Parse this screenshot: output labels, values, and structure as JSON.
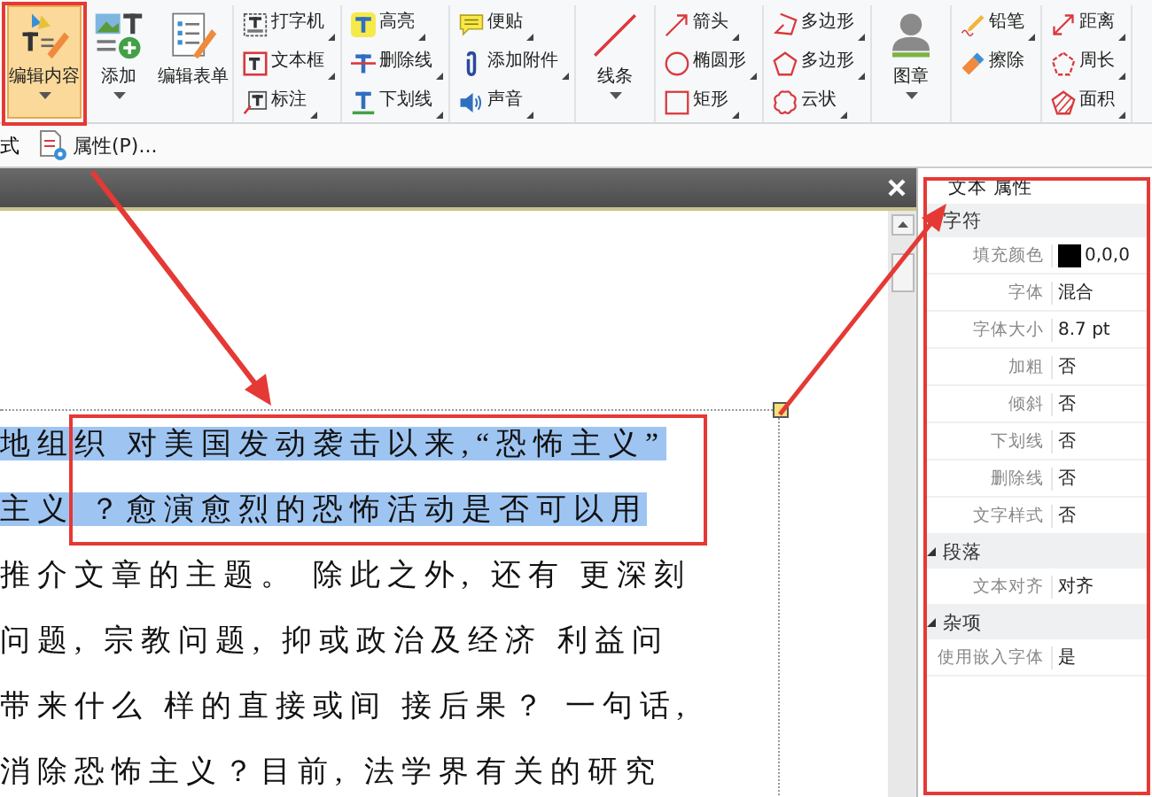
{
  "ribbon": {
    "groups": [
      {
        "kind": "large",
        "items": [
          {
            "label": "编辑内容",
            "selected": true,
            "menu": true
          },
          {
            "label": "添加",
            "selected": false,
            "menu": true
          },
          {
            "label": "编辑表单",
            "selected": false,
            "menu": false
          }
        ]
      },
      {
        "kind": "small",
        "items": [
          {
            "label": "打字机",
            "selected": false,
            "menu": true
          },
          {
            "label": "文本框",
            "selected": false,
            "menu": true
          },
          {
            "label": "标注",
            "selected": false,
            "menu": true
          }
        ]
      },
      {
        "kind": "small",
        "items": [
          {
            "label": "高亮",
            "selected": false,
            "menu": true
          },
          {
            "label": "删除线",
            "selected": false,
            "menu": true
          },
          {
            "label": "下划线",
            "selected": false,
            "menu": true
          }
        ]
      },
      {
        "kind": "small",
        "items": [
          {
            "label": "便贴",
            "selected": false,
            "menu": true
          },
          {
            "label": "添加附件",
            "selected": false,
            "menu": true
          },
          {
            "label": "声音",
            "selected": false,
            "menu": true
          }
        ]
      },
      {
        "kind": "large",
        "items": [
          {
            "label": "线条",
            "selected": false,
            "menu": true
          }
        ]
      },
      {
        "kind": "small",
        "items": [
          {
            "label": "箭头",
            "selected": false,
            "menu": true
          },
          {
            "label": "椭圆形",
            "selected": false,
            "menu": true
          },
          {
            "label": "矩形",
            "selected": false,
            "menu": true
          }
        ]
      },
      {
        "kind": "small",
        "items": [
          {
            "label": "多边形",
            "selected": false,
            "menu": true
          },
          {
            "label": "多边形",
            "selected": false,
            "menu": true
          },
          {
            "label": "云状",
            "selected": false,
            "menu": true
          }
        ]
      },
      {
        "kind": "large",
        "items": [
          {
            "label": "图章",
            "selected": false,
            "menu": true
          }
        ]
      },
      {
        "kind": "small",
        "items": [
          {
            "label": "铅笔",
            "selected": false,
            "menu": true
          },
          {
            "label": "擦除",
            "selected": false,
            "menu": false
          }
        ]
      },
      {
        "kind": "small",
        "items": [
          {
            "label": "距离",
            "selected": false,
            "menu": true
          },
          {
            "label": "周长",
            "selected": false,
            "menu": true
          },
          {
            "label": "面积",
            "selected": false,
            "menu": true
          }
        ]
      }
    ]
  },
  "toolbar": {
    "cut_label": "式",
    "properties_button": "属性(P)..."
  },
  "document": {
    "lines": [
      {
        "text": "地组织 对美国发动袭击以来,“恐怖主义”",
        "selected": true
      },
      {
        "text": "主义 ？愈演愈烈的恐怖活动是否可以用",
        "selected": true
      },
      {
        "text": "推介文章的主题。 除此之外, 还有 更深刻",
        "selected": false
      },
      {
        "text": "问题, 宗教问题, 抑或政治及经济 利益问",
        "selected": false
      },
      {
        "text": "带来什么 样的直接或间 接后果？ 一句话,",
        "selected": false
      },
      {
        "text": "消除恐怖主义？目前, 法学界有关的研究",
        "selected": false
      }
    ]
  },
  "properties": {
    "title": "文本 属性",
    "sections": [
      {
        "name": "字符",
        "expanded": true,
        "rows": [
          {
            "label": "填充颜色",
            "value": "0,0,0",
            "color": "#000000"
          },
          {
            "label": "字体",
            "value": "混合"
          },
          {
            "label": "字体大小",
            "value": "8.7 pt"
          },
          {
            "label": "加粗",
            "value": "否"
          },
          {
            "label": "倾斜",
            "value": "否"
          },
          {
            "label": "下划线",
            "value": "否"
          },
          {
            "label": "删除线",
            "value": "否"
          },
          {
            "label": "文字样式",
            "value": "否"
          }
        ]
      },
      {
        "name": "段落",
        "expanded": true,
        "rows": [
          {
            "label": "文本对齐",
            "value": "对齐"
          }
        ]
      },
      {
        "name": "杂项",
        "expanded": true,
        "rows": [
          {
            "label": "使用嵌入字体",
            "value": "是"
          }
        ]
      }
    ]
  }
}
